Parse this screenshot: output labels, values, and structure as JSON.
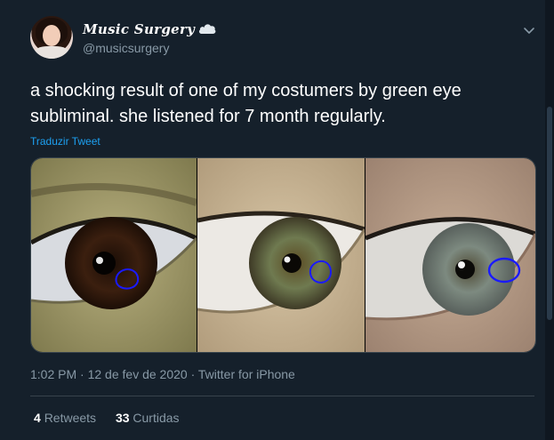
{
  "tweet": {
    "display_name": "Music Surgery",
    "handle": "@musicsurgery",
    "text": "a shocking result of one of my costumers by green eye subliminal. she listened for 7 month regularly.",
    "translate_label": "Traduzir Tweet",
    "time": "1:02 PM",
    "date": "12 de fev de 2020",
    "source": "Twitter for iPhone",
    "separator": "·",
    "retweets_count": "4",
    "retweets_label": "Retweets",
    "likes_count": "33",
    "likes_label": "Curtidas"
  },
  "icons": {
    "verified": "cloud-icon",
    "more": "chevron-down-icon"
  },
  "colors": {
    "background": "#15202b",
    "text": "#ffffff",
    "muted": "#8899a6",
    "link": "#1da1f2",
    "border": "#38444d",
    "annotation": "#1a1aff"
  }
}
